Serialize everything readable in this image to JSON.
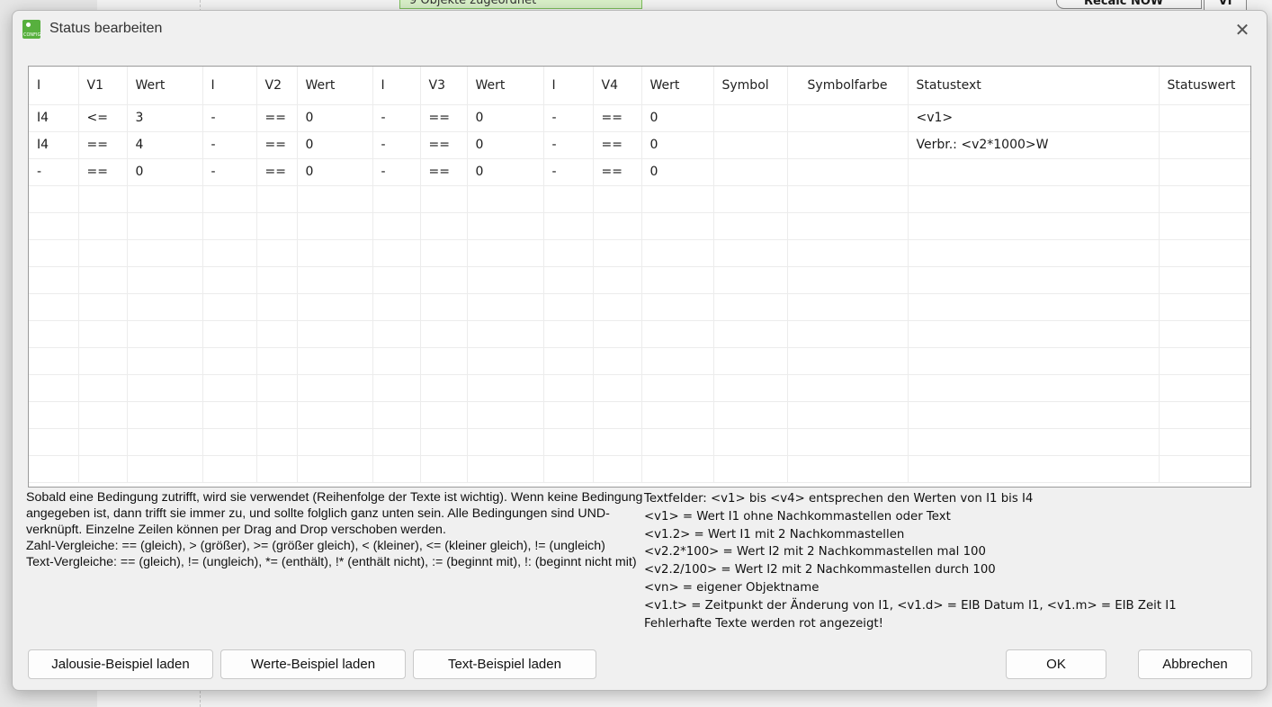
{
  "background": {
    "green_label": "9 Objekte zugeordnet",
    "recalc_button": "Recalc NOW",
    "vi_button": "VI"
  },
  "dialog": {
    "title": "Status bearbeiten",
    "icon_caption": "CONFIG",
    "close_glyph": "✕"
  },
  "table": {
    "headers": [
      "I",
      "V1",
      "Wert",
      "I",
      "V2",
      "Wert",
      "I",
      "V3",
      "Wert",
      "I",
      "V4",
      "Wert",
      "Symbol",
      "Symbolfarbe",
      "Statustext",
      "Statuswert"
    ],
    "rows": [
      [
        "I4",
        "<=",
        "3",
        "-",
        "==",
        "0",
        "-",
        "==",
        "0",
        "-",
        "==",
        "0",
        "",
        "",
        "<v1>",
        ""
      ],
      [
        "I4",
        "==",
        "4",
        "-",
        "==",
        "0",
        "-",
        "==",
        "0",
        "-",
        "==",
        "0",
        "",
        "",
        "Verbr.: <v2*1000>W",
        ""
      ],
      [
        "-",
        "==",
        "0",
        "-",
        "==",
        "0",
        "-",
        "==",
        "0",
        "-",
        "==",
        "0",
        "",
        "",
        "",
        ""
      ]
    ],
    "empty_rows": 11
  },
  "help_left": [
    "Sobald eine Bedingung zutrifft, wird sie verwendet (Reihenfolge der Texte ist wichtig). Wenn keine Bedingung angegeben ist, dann trifft sie immer zu, und sollte folglich ganz unten sein. Alle Bedingungen sind UND-verknüpft. Einzelne Zeilen können per Drag and Drop verschoben werden.",
    "Zahl-Vergleiche: == (gleich), > (größer), >= (größer gleich), < (kleiner), <= (kleiner gleich), != (ungleich)",
    "Text-Vergleiche: == (gleich), != (ungleich), *= (enthält), !* (enthält nicht), := (beginnt mit), !: (beginnt nicht mit)"
  ],
  "help_right": [
    "Textfelder: <v1> bis <v4> entsprechen den Werten von I1 bis I4",
    "<v1> = Wert I1 ohne Nachkommastellen oder Text",
    "<v1.2> = Wert I1 mit 2 Nachkommastellen",
    "<v2.2*100> = Wert I2 mit 2 Nachkommastellen mal 100",
    "<v2.2/100> = Wert I2 mit 2 Nachkommastellen durch 100",
    "<vn> = eigener Objektname",
    "<v1.t> = Zeitpunkt der Änderung von I1, <v1.d> = EIB Datum I1, <v1.m> = EIB Zeit I1",
    "Fehlerhafte Texte werden rot angezeigt!"
  ],
  "buttons": {
    "jalousie": "Jalousie-Beispiel laden",
    "werte": "Werte-Beispiel laden",
    "text": "Text-Beispiel laden",
    "ok": "OK",
    "cancel": "Abbrechen"
  }
}
